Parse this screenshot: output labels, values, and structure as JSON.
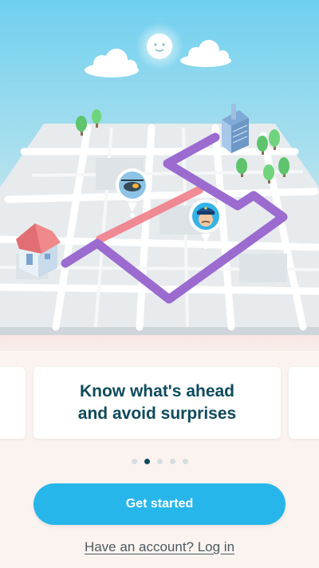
{
  "onboarding": {
    "headline_line1": "Know what's ahead",
    "headline_line2": "and avoid surprises",
    "pages": 5,
    "active_page": 2
  },
  "actions": {
    "primary_label": "Get started",
    "secondary_label": "Have an account? Log in"
  },
  "illustration": {
    "icons": [
      "sun-icon",
      "cloud-icon",
      "cloud-icon",
      "building-icon",
      "tree-icon",
      "house-icon",
      "helicopter-pin-icon",
      "police-pin-icon"
    ]
  },
  "colors": {
    "primary": "#27b6ea",
    "headline": "#0f4a5c",
    "route": "#9b6bd0",
    "traffic": "#f07e89"
  }
}
